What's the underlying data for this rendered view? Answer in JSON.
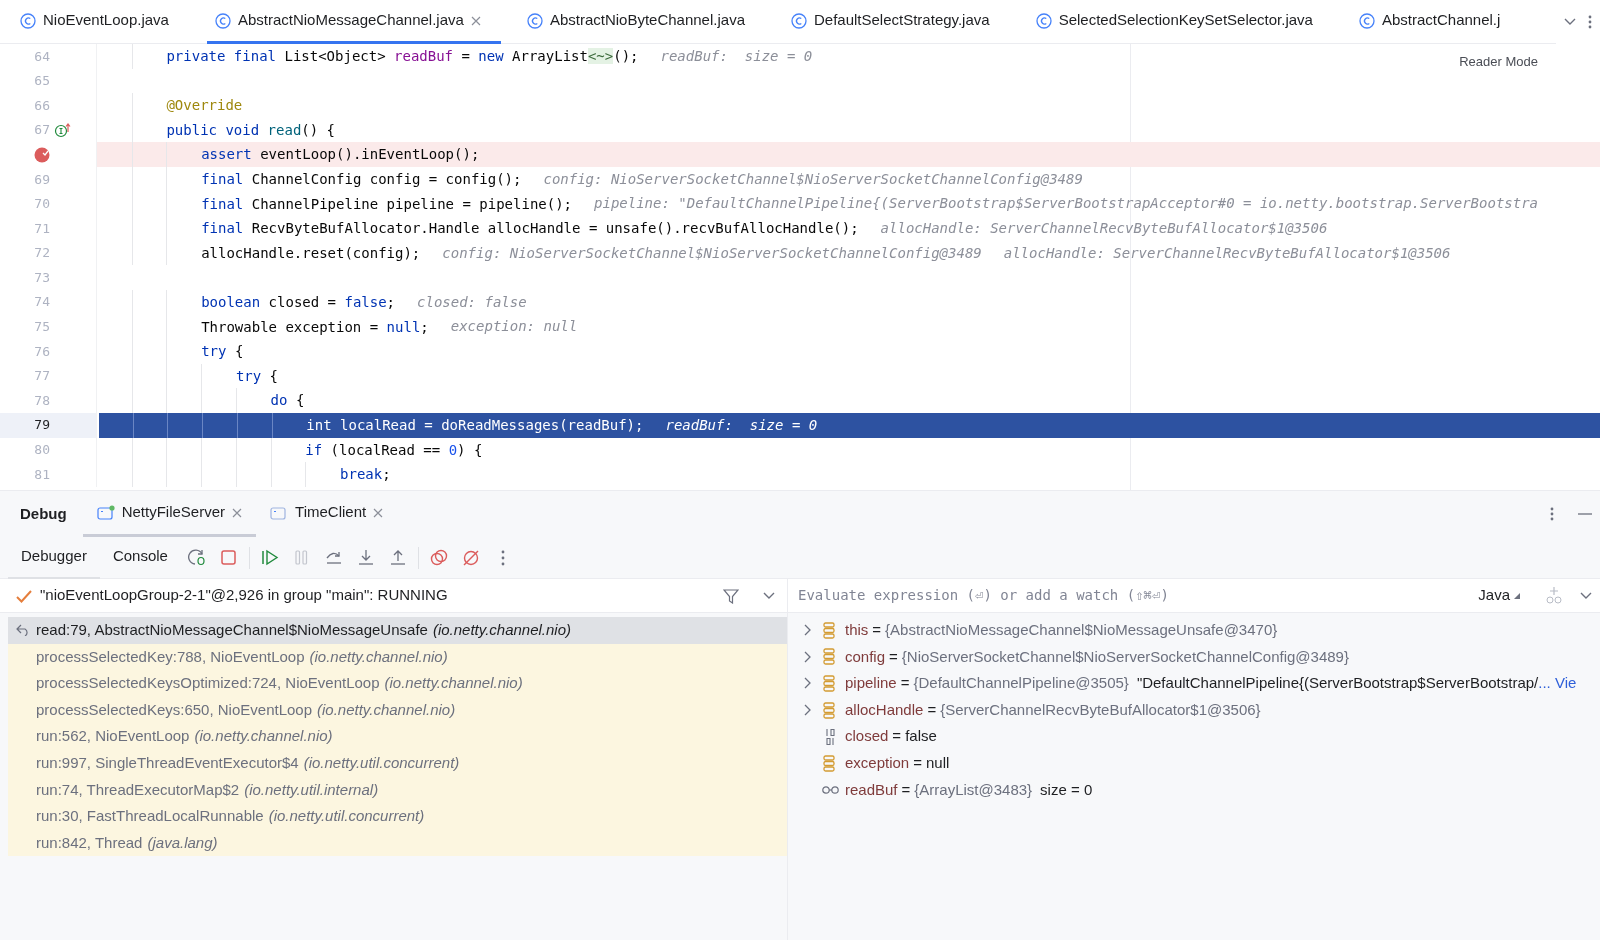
{
  "editor_tabs": [
    {
      "label": "NioEventLoop.java",
      "selected": false
    },
    {
      "label": "AbstractNioMessageChannel.java",
      "selected": true
    },
    {
      "label": "AbstractNioByteChannel.java",
      "selected": false
    },
    {
      "label": "DefaultSelectStrategy.java",
      "selected": false
    },
    {
      "label": "SelectedSelectionKeySetSelector.java",
      "selected": false
    },
    {
      "label": "AbstractChannel.j",
      "selected": false
    }
  ],
  "editor": {
    "reader_mode": "Reader Mode",
    "lines": [
      {
        "number": "64",
        "current": false,
        "breakpoint": false,
        "tokens": [
          {
            "kind": "keyword",
            "text": "        private final "
          },
          {
            "kind": "plain",
            "text": "List<Object> "
          },
          {
            "kind": "field",
            "text": "readBuf"
          },
          {
            "kind": "plain",
            "text": " = "
          },
          {
            "kind": "keyword",
            "text": "new "
          },
          {
            "kind": "plain",
            "text": "ArrayList"
          },
          {
            "kind": "folded",
            "text": "<~>"
          },
          {
            "kind": "plain",
            "text": "();"
          }
        ],
        "hints": [
          "readBuf:  size = 0"
        ]
      },
      {
        "number": "65",
        "current": false,
        "breakpoint": false
      },
      {
        "number": "66",
        "current": false,
        "breakpoint": false,
        "tokens": [
          {
            "kind": "annotation",
            "text": "        @Override"
          }
        ]
      },
      {
        "number": "67",
        "current": false,
        "breakpoint": false,
        "implements_marker": true,
        "tokens": [
          {
            "kind": "keyword",
            "text": "        public void "
          },
          {
            "kind": "method",
            "text": "read"
          },
          {
            "kind": "plain",
            "text": "() {"
          }
        ]
      },
      {
        "current": false,
        "breakpoint": true,
        "tokens": [
          {
            "kind": "keyword",
            "text": "            assert "
          },
          {
            "kind": "plain",
            "text": "eventLoop().inEventLoop();"
          }
        ]
      },
      {
        "number": "69",
        "current": false,
        "breakpoint": false,
        "tokens": [
          {
            "kind": "keyword",
            "text": "            final "
          },
          {
            "kind": "plain",
            "text": "ChannelConfig config = config();"
          }
        ],
        "hints": [
          "config: NioServerSocketChannel$NioServerSocketChannelConfig@3489"
        ]
      },
      {
        "number": "70",
        "current": false,
        "breakpoint": false,
        "tokens": [
          {
            "kind": "keyword",
            "text": "            final "
          },
          {
            "kind": "plain",
            "text": "ChannelPipeline pipeline = pipeline();"
          }
        ],
        "hints": [
          "pipeline: \"DefaultChannelPipeline{(ServerBootstrap$ServerBootstrapAcceptor#0 = io.netty.bootstrap.ServerBootstra"
        ]
      },
      {
        "number": "71",
        "current": false,
        "breakpoint": false,
        "tokens": [
          {
            "kind": "keyword",
            "text": "            final "
          },
          {
            "kind": "plain",
            "text": "RecvByteBufAllocator.Handle allocHandle = unsafe().recvBufAllocHandle();"
          }
        ],
        "hints": [
          "allocHandle: ServerChannelRecvByteBufAllocator$1@3506"
        ]
      },
      {
        "number": "72",
        "current": false,
        "breakpoint": false,
        "tokens": [
          {
            "kind": "plain",
            "text": "            allocHandle.reset(config);"
          }
        ],
        "hints": [
          "config: NioServerSocketChannel$NioServerSocketChannelConfig@3489",
          "allocHandle: ServerChannelRecvByteBufAllocator$1@3506"
        ]
      },
      {
        "number": "73",
        "current": false,
        "breakpoint": false
      },
      {
        "number": "74",
        "current": false,
        "breakpoint": false,
        "tokens": [
          {
            "kind": "keyword",
            "text": "            boolean "
          },
          {
            "kind": "plain",
            "text": "closed = "
          },
          {
            "kind": "keyword",
            "text": "false"
          },
          {
            "kind": "plain",
            "text": ";"
          }
        ],
        "hints": [
          "closed: false"
        ]
      },
      {
        "number": "75",
        "current": false,
        "breakpoint": false,
        "tokens": [
          {
            "kind": "plain",
            "text": "            Throwable exception = "
          },
          {
            "kind": "keyword",
            "text": "null"
          },
          {
            "kind": "plain",
            "text": ";"
          }
        ],
        "hints": [
          "exception: null"
        ]
      },
      {
        "number": "76",
        "current": false,
        "breakpoint": false,
        "tokens": [
          {
            "kind": "keyword",
            "text": "            try "
          },
          {
            "kind": "plain",
            "text": "{"
          }
        ]
      },
      {
        "number": "77",
        "current": false,
        "breakpoint": false,
        "tokens": [
          {
            "kind": "keyword",
            "text": "                try "
          },
          {
            "kind": "plain",
            "text": "{"
          }
        ]
      },
      {
        "number": "78",
        "current": false,
        "breakpoint": false,
        "tokens": [
          {
            "kind": "keyword",
            "text": "                    do "
          },
          {
            "kind": "plain",
            "text": "{"
          }
        ]
      },
      {
        "number": "79",
        "current": true,
        "breakpoint": false,
        "tokens": [
          {
            "kind": "keyword",
            "text": "                        int "
          },
          {
            "kind": "plain",
            "text": "localRead = doReadMessages(readBuf);"
          }
        ],
        "hints": [
          "readBuf:  size = 0"
        ]
      },
      {
        "number": "80",
        "current": false,
        "breakpoint": false,
        "tokens": [
          {
            "kind": "keyword",
            "text": "                        if "
          },
          {
            "kind": "plain",
            "text": "(localRead == "
          },
          {
            "kind": "number",
            "text": "0"
          },
          {
            "kind": "plain",
            "text": ") {"
          }
        ]
      },
      {
        "number": "81",
        "current": false,
        "breakpoint": false,
        "tokens": [
          {
            "kind": "keyword",
            "text": "                            break"
          },
          {
            "kind": "plain",
            "text": ";"
          }
        ]
      }
    ]
  },
  "debug": {
    "title": "Debug",
    "sessions": [
      {
        "label": "NettyFileServer",
        "selected": true,
        "running": true
      },
      {
        "label": "TimeClient",
        "selected": false,
        "running": false
      }
    ],
    "views": [
      {
        "label": "Debugger",
        "selected": true
      },
      {
        "label": "Console",
        "selected": false
      }
    ],
    "thread": "\"nioEventLoopGroup-2-1\"@2,926 in group \"main\": RUNNING",
    "frames": [
      {
        "location": "read:79, AbstractNioMessageChannel$NioMessageUnsafe",
        "package": "(io.netty.channel.nio)",
        "selected": true,
        "library": false
      },
      {
        "location": "processSelectedKey:788, NioEventLoop",
        "package": "(io.netty.channel.nio)",
        "selected": false,
        "library": true
      },
      {
        "location": "processSelectedKeysOptimized:724, NioEventLoop",
        "package": "(io.netty.channel.nio)",
        "selected": false,
        "library": true
      },
      {
        "location": "processSelectedKeys:650, NioEventLoop",
        "package": "(io.netty.channel.nio)",
        "selected": false,
        "library": true
      },
      {
        "location": "run:562, NioEventLoop",
        "package": "(io.netty.channel.nio)",
        "selected": false,
        "library": true
      },
      {
        "location": "run:997, SingleThreadEventExecutor$4",
        "package": "(io.netty.util.concurrent)",
        "selected": false,
        "library": true
      },
      {
        "location": "run:74, ThreadExecutorMap$2",
        "package": "(io.netty.util.internal)",
        "selected": false,
        "library": true
      },
      {
        "location": "run:30, FastThreadLocalRunnable",
        "package": "(io.netty.util.concurrent)",
        "selected": false,
        "library": true
      },
      {
        "location": "run:842, Thread",
        "package": "(java.lang)",
        "selected": false,
        "library": true
      }
    ],
    "evaluate": {
      "placeholder": "Evaluate expression (⏎) or add a watch (⇧⌘⏎)",
      "language": "Java"
    },
    "variables": [
      {
        "kind": "field",
        "expandable": true,
        "name": "this",
        "sep": "=",
        "value": "{AbstractNioMessageChannel$NioMessageUnsafe@3470}"
      },
      {
        "kind": "field",
        "expandable": true,
        "name": "config",
        "sep": "=",
        "value": "{NioServerSocketChannel$NioServerSocketChannelConfig@3489}"
      },
      {
        "kind": "field",
        "expandable": true,
        "name": "pipeline",
        "sep": "=",
        "value": "{DefaultChannelPipeline@3505}",
        "extra": "\"DefaultChannelPipeline{(ServerBootstrap$ServerBootstrap/",
        "link": "... Vie"
      },
      {
        "kind": "field",
        "expandable": true,
        "name": "allocHandle",
        "sep": "=",
        "value": "{ServerChannelRecvByteBufAllocator$1@3506}"
      },
      {
        "kind": "primitive",
        "expandable": false,
        "name": "closed",
        "sep": "=",
        "extra": "false"
      },
      {
        "kind": "field",
        "expandable": false,
        "name": "exception",
        "sep": "=",
        "extra": "null"
      },
      {
        "kind": "watch",
        "expandable": false,
        "name": "readBuf",
        "sep": "=",
        "value": "{ArrayList@3483}",
        "extra": "size = 0"
      }
    ]
  }
}
